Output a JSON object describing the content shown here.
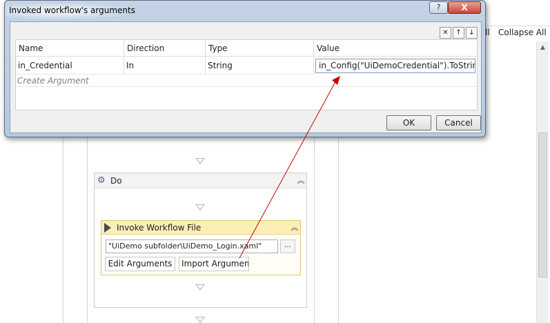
{
  "designer": {
    "expand_all_fragment": "ll",
    "collapse_all_label": "Collapse All",
    "do_title": "Do",
    "invoke_title": "Invoke Workflow File",
    "workflow_path": "\"UiDemo subfolder\\UiDemo_Login.xaml\"",
    "browse_label": "...",
    "edit_arguments_label": "Edit Arguments",
    "import_arguments_label": "Import Arguments"
  },
  "dialog": {
    "title": "Invoked workflow's arguments",
    "help_label": "?",
    "close_label": "X",
    "toolbar": {
      "delete_label": "✕",
      "up_label": "↑",
      "down_label": "↓"
    },
    "columns": [
      "Name",
      "Direction",
      "Type",
      "Value"
    ],
    "rows": [
      {
        "name": "in_Credential",
        "direction": "In",
        "type": "String",
        "value": "in_Config(\"UiDemoCredential\").ToStrin"
      }
    ],
    "create_argument_label": "Create Argument",
    "ok_label": "OK",
    "cancel_label": "Cancel"
  },
  "colors": {
    "annotation_arrow": "#cc0000",
    "invoke_header": "#fbeeb6",
    "close_button": "#c8453a"
  }
}
